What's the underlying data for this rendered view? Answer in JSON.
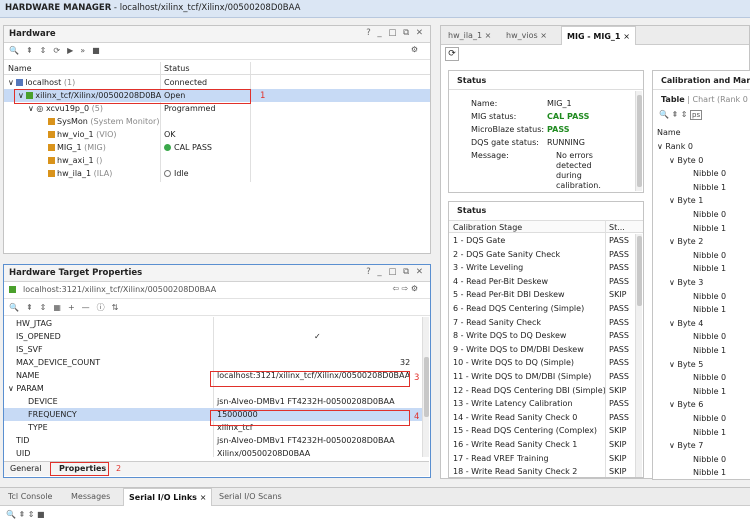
{
  "title": {
    "app": "HARDWARE MANAGER",
    "path": "localhost/xilinx_tcf/Xilinx/00500208D0BAA"
  },
  "hardware": {
    "title": "Hardware",
    "controls": "? _ □ ⧉ ✕",
    "columns": [
      "Name",
      "Status"
    ],
    "rows": [
      {
        "name": "localhost",
        "extra": "(1)",
        "status": "Connected"
      },
      {
        "name": "xilinx_tcf/Xilinx/00500208D0BA",
        "extra": "",
        "status": "Open"
      },
      {
        "name": "xcvu19p_0",
        "extra": "(5)",
        "status": "Programmed"
      },
      {
        "name": "SysMon",
        "extra": "(System Monitor)",
        "status": ""
      },
      {
        "name": "hw_vio_1",
        "extra": "(VIO)",
        "status": "OK"
      },
      {
        "name": "MIG_1",
        "extra": "(MIG)",
        "status": "CAL PASS"
      },
      {
        "name": "hw_axi_1",
        "extra": "()",
        "status": ""
      },
      {
        "name": "hw_ila_1",
        "extra": "(ILA)",
        "status": "Idle"
      }
    ],
    "marker": "1"
  },
  "props": {
    "title": "Hardware Target Properties",
    "controls": "? _ □ ⧉ ✕",
    "target": "localhost:3121/xilinx_tcf/Xilinx/00500208D0BAA",
    "rows": [
      {
        "name": "HW_JTAG",
        "value": ""
      },
      {
        "name": "IS_OPENED",
        "value": "✓"
      },
      {
        "name": "IS_SVF",
        "value": ""
      },
      {
        "name": "MAX_DEVICE_COUNT",
        "value": "32"
      },
      {
        "name": "NAME",
        "value": "localhost:3121/xilinx_tcf/Xilinx/00500208D0BAA"
      },
      {
        "name": "PARAM",
        "value": ""
      },
      {
        "name": "DEVICE",
        "value": "jsn-Alveo-DMBv1 FT4232H-00500208D0BAA"
      },
      {
        "name": "FREQUENCY",
        "value": "15000000"
      },
      {
        "name": "TYPE",
        "value": "xilinx_tcf"
      },
      {
        "name": "TID",
        "value": "jsn-Alveo-DMBv1 FT4232H-00500208D0BAA"
      },
      {
        "name": "UID",
        "value": "Xilinx/00500208D0BAA"
      }
    ],
    "tabs": [
      "General",
      "Properties"
    ],
    "markers": [
      "3",
      "4",
      "2"
    ]
  },
  "right_tabs": [
    "hw_ila_1",
    "hw_vios",
    "MIG - MIG_1"
  ],
  "mig_status": {
    "title": "Status",
    "name_label": "Name:",
    "name": "MIG_1",
    "mig_label": "MIG status:",
    "mig": "CAL PASS",
    "mb_label": "MicroBlaze status:",
    "mb": "PASS",
    "dqs_label": "DQS gate status:",
    "dqs": "RUNNING",
    "msg_label": "Message:",
    "msg": "No errors detected during calibration."
  },
  "cal_status": {
    "title": "Status",
    "columns": [
      "Calibration Stage",
      "St..."
    ],
    "stages": [
      [
        "1 - DQS Gate",
        "PASS"
      ],
      [
        "2 - DQS Gate Sanity Check",
        "PASS"
      ],
      [
        "3 - Write Leveling",
        "PASS"
      ],
      [
        "4 - Read Per-Bit Deskew",
        "PASS"
      ],
      [
        "5 - Read Per-Bit DBI Deskew",
        "SKIP"
      ],
      [
        "6 - Read DQS Centering (Simple)",
        "PASS"
      ],
      [
        "7 - Read Sanity Check",
        "PASS"
      ],
      [
        "8 - Write DQS to DQ Deskew",
        "PASS"
      ],
      [
        "9 - Write DQS to DM/DBI Deskew",
        "PASS"
      ],
      [
        "10 - Write DQS to DQ (Simple)",
        "PASS"
      ],
      [
        "11 - Write DQS to DM/DBI (Simple)",
        "PASS"
      ],
      [
        "12 - Read DQS Centering DBI (Simple)",
        "SKIP"
      ],
      [
        "13 - Write Latency Calibration",
        "PASS"
      ],
      [
        "14 - Write Read Sanity Check 0",
        "PASS"
      ],
      [
        "15 - Read DQS Centering (Complex)",
        "SKIP"
      ],
      [
        "16 - Write Read Sanity Check 1",
        "SKIP"
      ],
      [
        "17 - Read VREF Training",
        "SKIP"
      ],
      [
        "18 - Write Read Sanity Check 2",
        "SKIP"
      ]
    ]
  },
  "cal_margins": {
    "title": "Calibration and Marg",
    "view_table": "Table",
    "view_chart": "Chart (Rank 0",
    "col": "Name",
    "tree": [
      {
        "label": "Rank 0",
        "level": 0
      },
      {
        "label": "Byte 0",
        "level": 1
      },
      {
        "label": "Nibble 0",
        "level": 2
      },
      {
        "label": "Nibble 1",
        "level": 2
      },
      {
        "label": "Byte 1",
        "level": 1
      },
      {
        "label": "Nibble 0",
        "level": 2
      },
      {
        "label": "Nibble 1",
        "level": 2
      },
      {
        "label": "Byte 2",
        "level": 1
      },
      {
        "label": "Nibble 0",
        "level": 2
      },
      {
        "label": "Nibble 1",
        "level": 2
      },
      {
        "label": "Byte 3",
        "level": 1
      },
      {
        "label": "Nibble 0",
        "level": 2
      },
      {
        "label": "Nibble 1",
        "level": 2
      },
      {
        "label": "Byte 4",
        "level": 1
      },
      {
        "label": "Nibble 0",
        "level": 2
      },
      {
        "label": "Nibble 1",
        "level": 2
      },
      {
        "label": "Byte 5",
        "level": 1
      },
      {
        "label": "Nibble 0",
        "level": 2
      },
      {
        "label": "Nibble 1",
        "level": 2
      },
      {
        "label": "Byte 6",
        "level": 1
      },
      {
        "label": "Nibble 0",
        "level": 2
      },
      {
        "label": "Nibble 1",
        "level": 2
      },
      {
        "label": "Byte 7",
        "level": 1
      },
      {
        "label": "Nibble 0",
        "level": 2
      },
      {
        "label": "Nibble 1",
        "level": 2
      }
    ]
  },
  "bottom_tabs": [
    "Tcl Console",
    "Messages",
    "Serial I/O Links",
    "Serial I/O Scans"
  ],
  "colors": {
    "accent": "#c7daf5",
    "pass": "#1f8a1f",
    "marker": "#e0302a"
  }
}
